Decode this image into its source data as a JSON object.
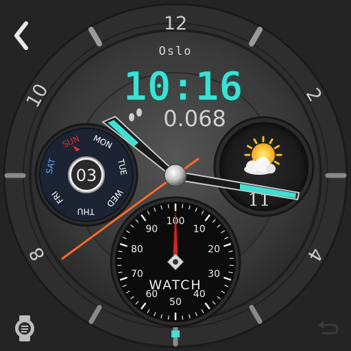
{
  "nav": {
    "back_icon": "chevron-left-icon",
    "return_icon": "undo-arrow-icon",
    "settings_icon": "watch-settings-icon"
  },
  "bezel": {
    "numerals": [
      "12",
      "2",
      "4",
      "8",
      "10"
    ]
  },
  "city": "Oslo",
  "time": {
    "display": "10:16"
  },
  "steps": {
    "icon": "footprints-icon",
    "value": "0.068"
  },
  "date_subdial": {
    "days": [
      "SUN",
      "MON",
      "TUE",
      "WED",
      "THU",
      "FRI",
      "SAT"
    ],
    "selected_day": "SUN",
    "day_number": "03"
  },
  "weather_subdial": {
    "icon": "partly-sunny-icon",
    "value": "11"
  },
  "watch_subdial": {
    "label": "WATCH",
    "numbers": [
      "100",
      "10",
      "20",
      "30",
      "40",
      "50",
      "60",
      "70",
      "80",
      "90"
    ]
  },
  "colors": {
    "accent_teal": "#3fe0d2",
    "hand_orange": "#ff6a28",
    "weekday_red": "#e03030",
    "weekday_blue": "#5aa6ff"
  }
}
